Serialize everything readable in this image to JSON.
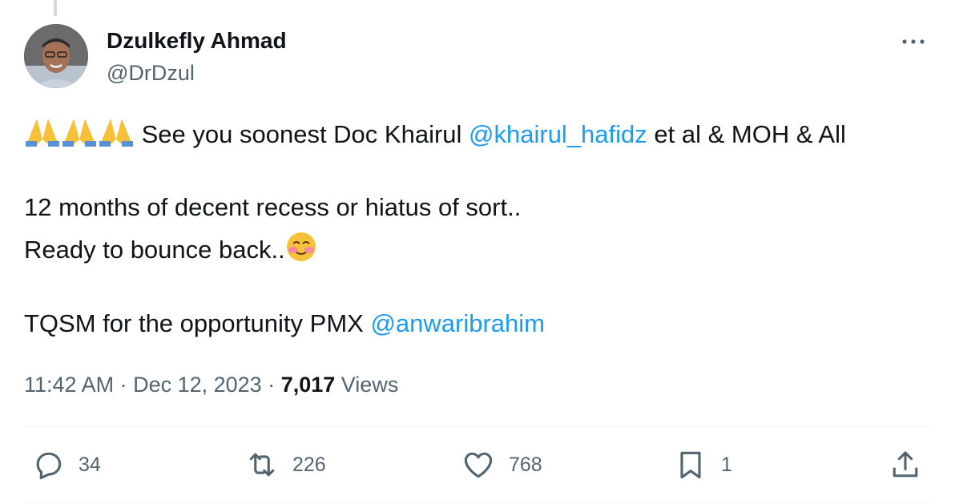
{
  "author": {
    "name": "Dzulkefly Ahmad",
    "handle": "@DrDzul"
  },
  "tweet": {
    "line1_text": " See you soonest Doc Khairul ",
    "line1_mention": "@khairul_hafidz",
    "line1_tail": "  et al & MOH & All",
    "line2": "12 months of decent recess or hiatus of sort..",
    "line3_text": "Ready to bounce back..",
    "line4_text": "TQSM for the opportunity PMX ",
    "line4_mention": "@anwaribrahim"
  },
  "meta": {
    "time": "11:42 AM",
    "separator": " · ",
    "date": "Dec 12, 2023",
    "separator2": " · ",
    "views_count": "7,017",
    "views_label": " Views"
  },
  "actions": {
    "replies": "34",
    "reposts": "226",
    "likes": "768",
    "bookmarks": "1"
  },
  "icons": {
    "prayer": "folded-hands-emoji",
    "smiling": "smiling-face-emoji",
    "reply": "reply-icon",
    "repost": "repost-icon",
    "like": "heart-icon",
    "bookmark": "bookmark-icon",
    "share": "share-icon",
    "more": "more-icon"
  },
  "colors": {
    "link": "#1d9bf0",
    "secondary": "#536471",
    "primary_text": "#0f1419"
  }
}
